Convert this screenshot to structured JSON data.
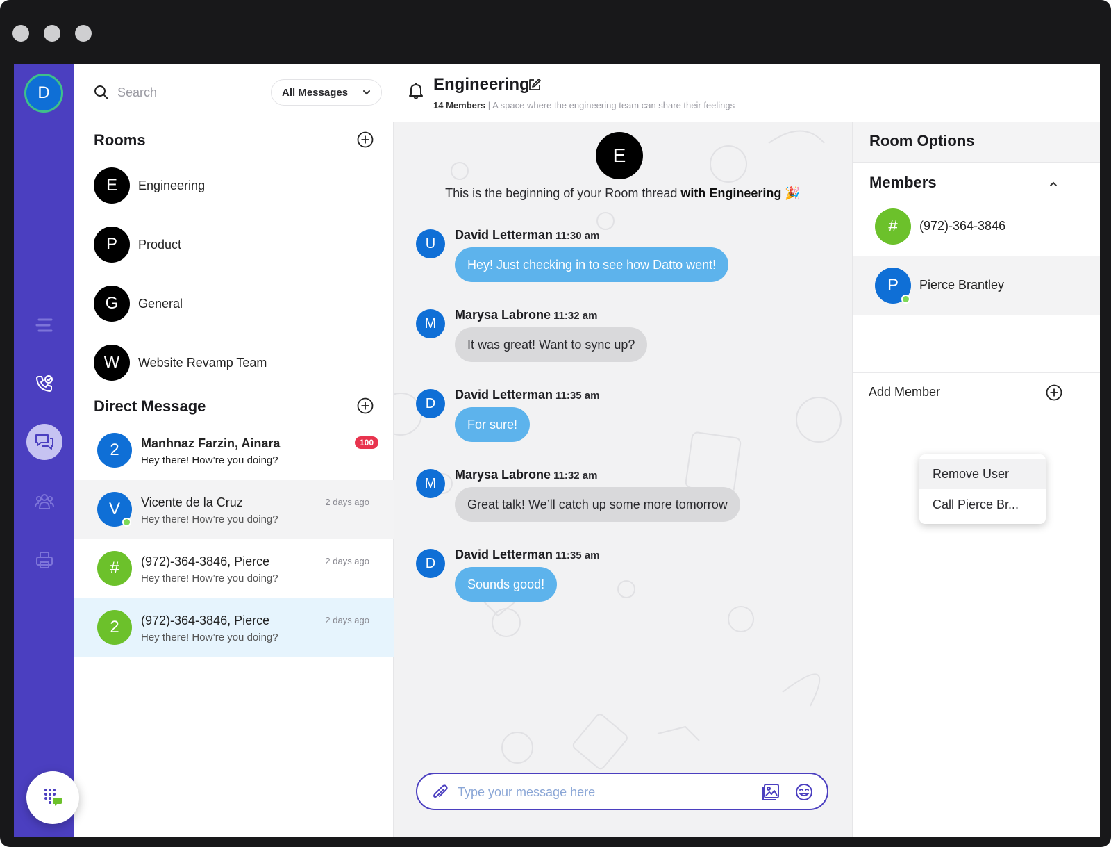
{
  "rail": {
    "avatar_initial": "D"
  },
  "search": {
    "placeholder": "Search",
    "filter_label": "All Messages"
  },
  "rooms": {
    "heading": "Rooms",
    "items": [
      {
        "initial": "E",
        "name": "Engineering"
      },
      {
        "initial": "P",
        "name": "Product"
      },
      {
        "initial": "G",
        "name": "General"
      },
      {
        "initial": "W",
        "name": "Website Revamp Team"
      }
    ]
  },
  "direct": {
    "heading": "Direct Message",
    "items": [
      {
        "initial": "2",
        "title": "Manhnaz Farzin, Ainara",
        "preview": "Hey there! How’re you doing?",
        "badge": "100",
        "time": "",
        "color": "#0f6fd6"
      },
      {
        "initial": "V",
        "title": "Vicente de la Cruz",
        "preview": "Hey there! How’re you doing?",
        "badge": "",
        "time": "2 days ago",
        "color": "#0f6fd6"
      },
      {
        "initial": "#",
        "title": "(972)-364-3846, Pierce",
        "preview": "Hey there! How’re you doing?",
        "badge": "",
        "time": "2 days ago",
        "color": "#6cc12b"
      },
      {
        "initial": "2",
        "title": "(972)-364-3846, Pierce",
        "preview": "Hey there! How’re you doing?",
        "badge": "",
        "time": "2 days ago",
        "color": "#6cc12b"
      }
    ]
  },
  "chat": {
    "title": "Engineering",
    "members_count": "14 Members",
    "separator": "|",
    "description": "A space where the engineering team can share their feelings",
    "thread_avatar": "E",
    "intro_prefix": "This is the beginning of your Room thread",
    "intro_bold": "with Engineering",
    "intro_emoji": "🎉",
    "messages": [
      {
        "initial": "U",
        "sender": "David Letterman",
        "time": "11:30 am",
        "text": "Hey! Just checking in to see how Datto went!",
        "mine": true
      },
      {
        "initial": "M",
        "sender": "Marysa Labrone",
        "time": "11:32 am",
        "text": "It was great! Want to sync up?",
        "mine": false
      },
      {
        "initial": "D",
        "sender": "David Letterman",
        "time": "11:35 am",
        "text": "For sure!",
        "mine": true
      },
      {
        "initial": "M",
        "sender": "Marysa Labrone",
        "time": "11:32 am",
        "text": "Great talk! We’ll catch up some more tomorrow",
        "mine": false
      },
      {
        "initial": "D",
        "sender": "David Letterman",
        "time": "11:35 am",
        "text": "Sounds good!",
        "mine": true
      }
    ],
    "composer_placeholder": "Type your message here"
  },
  "options": {
    "title": "Room Options",
    "members_heading": "Members",
    "members": [
      {
        "initial": "#",
        "name": "(972)-364-3846",
        "color": "#6cc12b"
      },
      {
        "initial": "P",
        "name": "Pierce Brantley",
        "color": "#0f6fd6"
      }
    ],
    "add_member_label": "Add Member",
    "context_menu": [
      "Remove User",
      "Call Pierce Br..."
    ]
  },
  "colors": {
    "rail": "#4b3fc0",
    "accent_blue": "#2d97ea",
    "bubble_mine": "#5db3ec",
    "bubble_theirs": "#d9d9db",
    "badge": "#e8344e",
    "online": "#7ed957"
  }
}
